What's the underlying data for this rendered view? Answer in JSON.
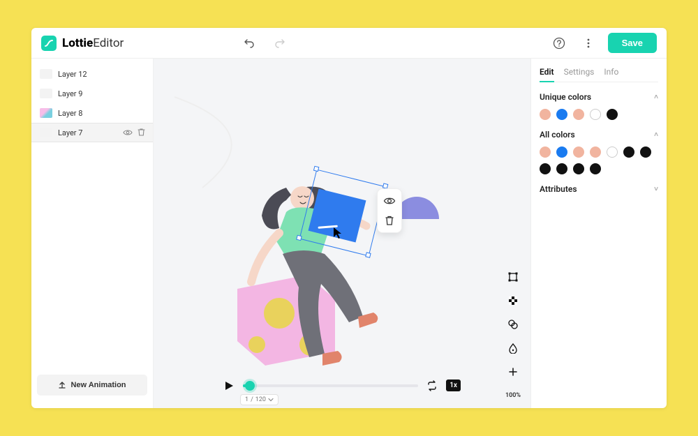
{
  "brand": {
    "bold": "Lottie",
    "light": "Editor"
  },
  "topbar": {
    "save_label": "Save"
  },
  "layers": {
    "items": [
      {
        "label": "Layer 12"
      },
      {
        "label": "Layer 9"
      },
      {
        "label": "Layer 8"
      },
      {
        "label": "Layer 7"
      }
    ],
    "selected_index": 3,
    "new_animation_label": "New Animation"
  },
  "timeline": {
    "current_frame": "1",
    "separator": "/",
    "total_frames": "120",
    "rate_label": "1x"
  },
  "toolstack": {
    "zoom_label": "100%"
  },
  "inspector": {
    "tabs": [
      {
        "label": "Edit"
      },
      {
        "label": "Settings"
      },
      {
        "label": "Info"
      }
    ],
    "active_tab": 0,
    "unique_colors": {
      "title": "Unique colors",
      "swatches": [
        "#f1b49f",
        "#1a7bf0",
        "#f1b49f",
        "#ffffff",
        "#111111"
      ]
    },
    "all_colors": {
      "title": "All colors",
      "swatches": [
        "#f1b49f",
        "#1a7bf0",
        "#f1b49f",
        "#f1b49f",
        "#ffffff",
        "#111111",
        "#111111",
        "#111111",
        "#111111",
        "#111111",
        "#111111"
      ]
    },
    "attributes": {
      "title": "Attributes"
    }
  }
}
